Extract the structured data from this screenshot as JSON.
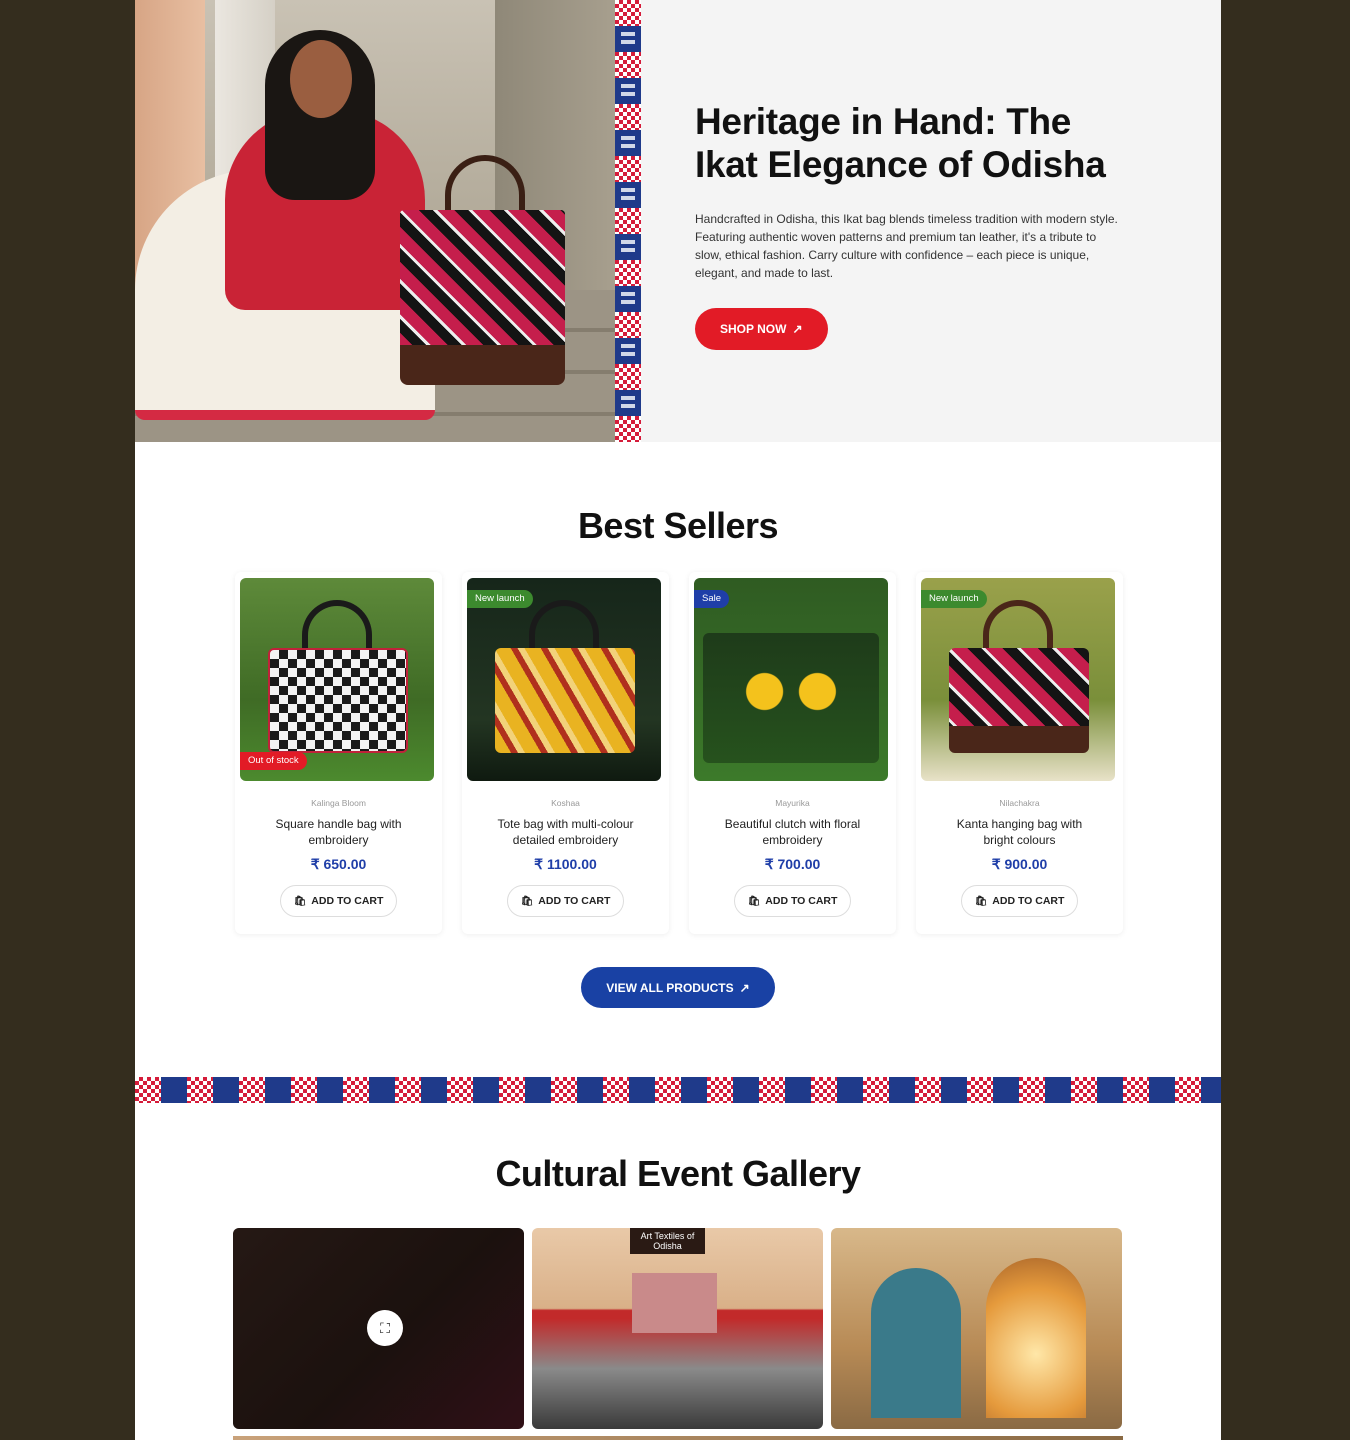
{
  "hero": {
    "title": "Heritage in Hand: The Ikat Elegance of Odisha",
    "description": "Handcrafted in Odisha, this Ikat bag blends timeless tradition with modern style. Featuring authentic woven patterns and premium tan leather, it's a tribute to slow, ethical fashion. Carry culture with confidence – each piece is unique, elegant, and made to last.",
    "cta_label": "SHOP NOW",
    "cta_icon": "arrow-up-right-icon"
  },
  "best_sellers": {
    "title": "Best Sellers",
    "add_to_cart_label": "ADD TO CART",
    "products": [
      {
        "badge": "",
        "bottom_badge": "Out of stock",
        "brand": "Kalinga Bloom",
        "name": "Square handle bag with embroidery",
        "price": "₹ 650.00"
      },
      {
        "badge": "New launch",
        "bottom_badge": "",
        "brand": "Koshaa",
        "name": "Tote bag with multi-colour detailed embroidery",
        "price": "₹ 1100.00"
      },
      {
        "badge": "Sale",
        "bottom_badge": "",
        "brand": "Mayurika",
        "name": "Beautiful clutch with floral embroidery",
        "price": "₹ 700.00"
      },
      {
        "badge": "New launch",
        "bottom_badge": "",
        "brand": "Nilachakra",
        "name": "Kanta hanging bag with bright colours",
        "price": "₹ 900.00"
      }
    ],
    "view_all_label": "VIEW ALL PRODUCTS"
  },
  "gallery": {
    "title": "Cultural Event Gallery",
    "sign_text": "Art Textiles of Odisha"
  },
  "colors": {
    "background": "#342d1e",
    "accent_red": "#e21b26",
    "accent_blue": "#1941a4",
    "badge_green": "#3c8a2e"
  }
}
